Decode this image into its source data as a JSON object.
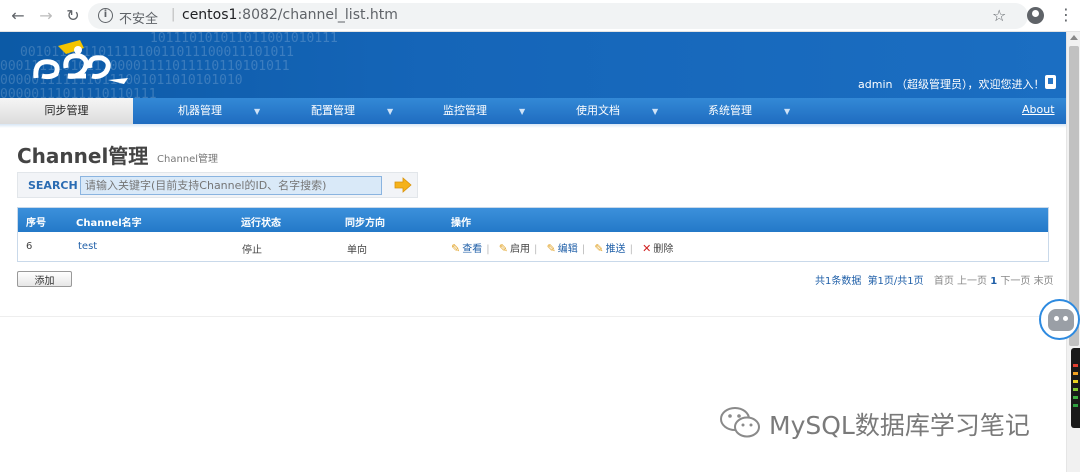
{
  "browser": {
    "insecure_label": "不安全",
    "separator": "|",
    "url_host": "centos1",
    "url_rest": ":8082/channel_list.htm"
  },
  "header": {
    "welcome": "admin （超级管理员），欢迎您进入！",
    "logo_icon": "otter-logo-icon"
  },
  "nav": {
    "items": [
      {
        "label": "同步管理",
        "active": true
      },
      {
        "label": "机器管理",
        "dropdown": true
      },
      {
        "label": "配置管理",
        "dropdown": true
      },
      {
        "label": "监控管理",
        "dropdown": true
      },
      {
        "label": "使用文档",
        "dropdown": true
      },
      {
        "label": "系统管理",
        "dropdown": true
      }
    ],
    "about": "About",
    "arrow": "▼"
  },
  "page": {
    "title": "Channel管理",
    "subtitle": "Channel管理"
  },
  "search": {
    "label": "SEARCH",
    "placeholder": "请输入关键字(目前支持Channel的ID、名字搜索)"
  },
  "table": {
    "headers": [
      "序号",
      "Channel名字",
      "运行状态",
      "同步方向",
      "操作"
    ],
    "rows": [
      {
        "id": "6",
        "name": "test",
        "status": "停止",
        "direction": "单向",
        "ops": [
          "查看",
          "启用",
          "编辑",
          "推送",
          "删除"
        ]
      }
    ]
  },
  "actions": {
    "add_label": "添加"
  },
  "pager": {
    "total": "共1条数据",
    "page_info": "第1页/共1页",
    "first": "首页",
    "prev": "上一页",
    "current": "1",
    "next": "下一页",
    "last": "末页"
  },
  "watermark": {
    "text": "MySQL数据库学习笔记",
    "icon": "wechat-icon"
  },
  "colors": {
    "banner": "#1565b8",
    "nav": "#2479c8",
    "link": "#1f5fa8"
  }
}
